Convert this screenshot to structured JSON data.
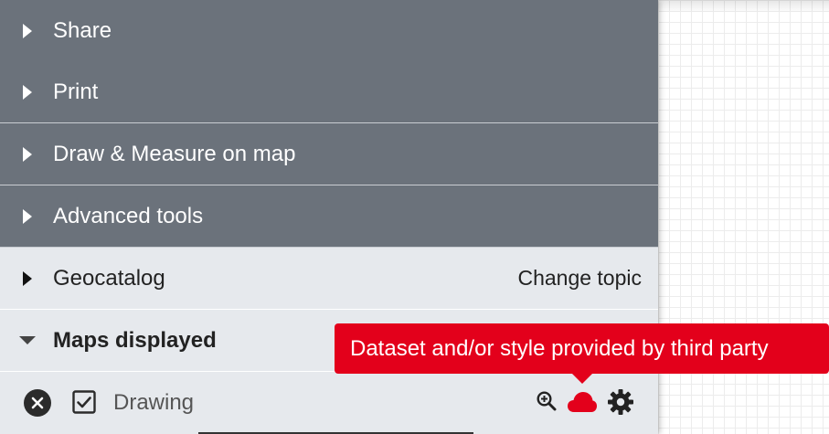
{
  "menu": {
    "items": [
      {
        "label": "Share"
      },
      {
        "label": "Print"
      },
      {
        "label": "Draw & Measure on map"
      },
      {
        "label": "Advanced tools"
      }
    ]
  },
  "geocatalog": {
    "label": "Geocatalog",
    "change_topic": "Change topic"
  },
  "maps_displayed": {
    "label": "Maps displayed"
  },
  "layer": {
    "name": "Drawing",
    "checked": true
  },
  "tooltip": {
    "text": "Dataset and/or style provided by third party"
  },
  "icons": {
    "caret_right": "caret-right-icon",
    "caret_down": "caret-down-icon",
    "remove": "close-circle-icon",
    "checkbox": "checkbox-checked-icon",
    "zoom": "zoom-in-icon",
    "cloud": "cloud-icon",
    "settings": "gear-icon"
  },
  "colors": {
    "menu_dark": "#6b727b",
    "panel_light": "#e6e9ed",
    "tooltip_red": "#e3001b"
  }
}
